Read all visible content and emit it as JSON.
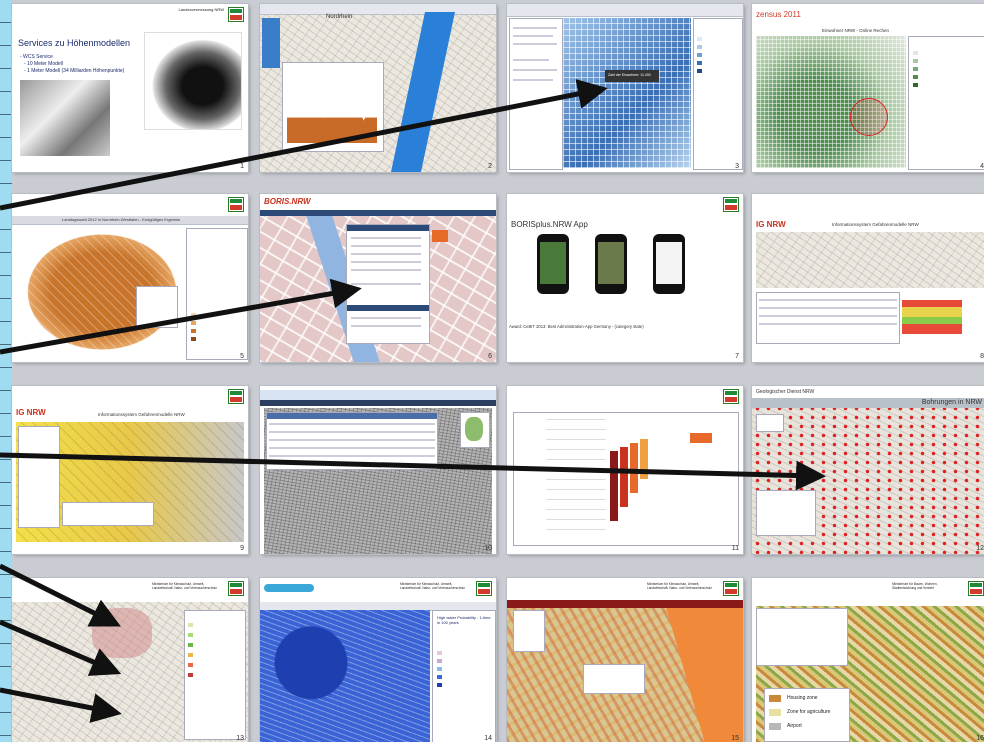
{
  "slides": [
    {
      "num": "1",
      "title": "Services zu Höhenmodellen",
      "bullets": [
        "- WCS Service",
        "- 10 Meter Modell",
        "- 1 Meter Modell (34 Milliarden Höhenpunkte)"
      ],
      "header": "Landesvermessung NRW"
    },
    {
      "num": "2",
      "label": "Nordrhein"
    },
    {
      "num": "3",
      "tooltip": "Zahl der Einwohner: 11.400"
    },
    {
      "num": "4",
      "logo": "zensus 2011",
      "map_title": "Einwohner NRW - Online Rechen"
    },
    {
      "num": "5",
      "map_title": "Landtagswahl 2012 in Nordrhein-Westfalen - Endgültiges Ergebnis"
    },
    {
      "num": "6",
      "logo": "BORIS.NRW"
    },
    {
      "num": "7",
      "title": "BORISplus.NRW App",
      "caption": "Award: CeBIT 2013: Best Administration-App Germany - (category state)"
    },
    {
      "num": "8",
      "logo": "IG NRW",
      "map_title": "Informationssystem Gefahrenmodelle NRW"
    },
    {
      "num": "9",
      "logo": "IG NRW",
      "map_title": "Informationssystem Gefahrenmodelle NRW"
    },
    {
      "num": "10"
    },
    {
      "num": "11"
    },
    {
      "num": "12",
      "header": "Geologischer Dienst NRW",
      "map_title": "Bohrungen in NRW"
    },
    {
      "num": "13",
      "header": "Ministerium für Klimaschutz, Umwelt, Landwirtschaft, Natur- und Verbraucherschutz"
    },
    {
      "num": "14",
      "header": "Ministerium für Klimaschutz, Umwelt, Landwirtschaft, Natur- und Verbraucherschutz",
      "map_title": "High water Probability - 1-time in 100 years"
    },
    {
      "num": "15",
      "header": "Ministerium für Klimaschutz, Umwelt, Landwirtschaft, Natur- und Verbraucherschutz"
    },
    {
      "num": "16",
      "header": "Ministerium für Bauen, Wohnen, Stadtentwicklung und Verkehr",
      "legend": [
        "Housing zone",
        "Zone for agriculture",
        "Airport"
      ]
    }
  ],
  "colors": {
    "background": "#c9ccd2",
    "arrow": "#111111",
    "left_strip": "#9fdcf2"
  }
}
